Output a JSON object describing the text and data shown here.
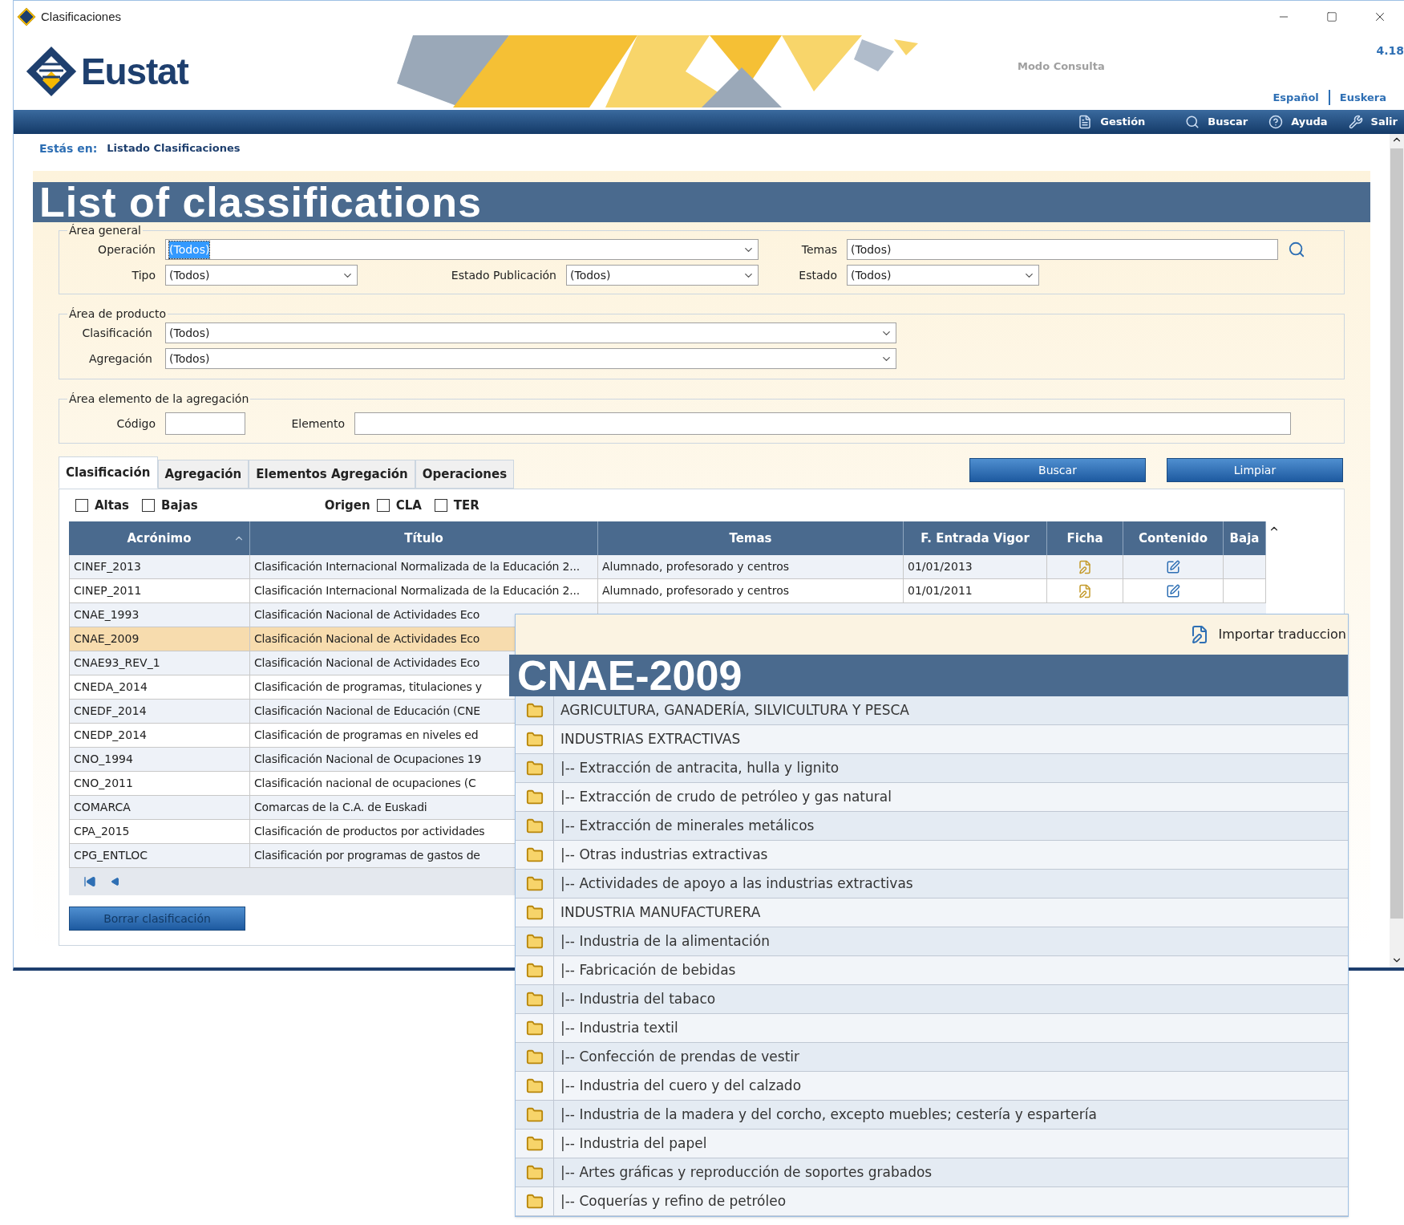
{
  "window": {
    "title": "Clasificaciones"
  },
  "header": {
    "logo_text": "Eustat",
    "mode": "Modo Consulta",
    "version": "4.18",
    "languages": [
      "Español",
      "Euskera"
    ]
  },
  "nav": [
    "Gestión",
    "Buscar",
    "Ayuda",
    "Salir"
  ],
  "breadcrumb": {
    "label": "Estás en:",
    "value": "Listado Clasificaciones"
  },
  "heading": "List of classifications",
  "area_general": {
    "legend": "Área general",
    "operacion": {
      "label": "Operación",
      "value": "(Todos)"
    },
    "temas": {
      "label": "Temas",
      "value": "(Todos)"
    },
    "tipo": {
      "label": "Tipo",
      "value": "(Todos)"
    },
    "estado_publicacion": {
      "label": "Estado Publicación",
      "value": "(Todos)"
    },
    "estado": {
      "label": "Estado",
      "value": "(Todos)"
    }
  },
  "area_producto": {
    "legend": "Área de producto",
    "clasificacion": {
      "label": "Clasificación",
      "value": "(Todos)"
    },
    "agregacion": {
      "label": "Agregación",
      "value": "(Todos)"
    }
  },
  "area_elemento": {
    "legend": "Área elemento de la agregación",
    "codigo": {
      "label": "Código"
    },
    "elemento": {
      "label": "Elemento"
    }
  },
  "tabs": [
    {
      "label": "Clasificación",
      "selected": true
    },
    {
      "label": "Agregación",
      "selected": false
    },
    {
      "label": "Elementos Agregación",
      "selected": false
    },
    {
      "label": "Operaciones",
      "selected": false
    }
  ],
  "buttons": [
    "Buscar",
    "Limpiar"
  ],
  "filters": {
    "altas": {
      "label": "Altas",
      "checked": false
    },
    "bajas": {
      "label": "Bajas",
      "checked": false
    },
    "origen": "Origen",
    "cla": {
      "label": "CLA",
      "checked": false
    },
    "ter": {
      "label": "TER",
      "checked": false
    }
  },
  "table": {
    "columns": [
      "Acrónimo",
      "Título",
      "Temas",
      "F. Entrada Vigor",
      "Ficha",
      "Contenido",
      "Baja"
    ],
    "rows": [
      {
        "acronimo": "CINEF_2013",
        "titulo": "Clasificación Internacional Normalizada de la Educación 2...",
        "temas": "Alumnado, profesorado y centros",
        "fecha": "01/01/2013",
        "selected": false
      },
      {
        "acronimo": "CINEP_2011",
        "titulo": "Clasificación Internacional Normalizada de la Educación 2...",
        "temas": "Alumnado, profesorado y centros",
        "fecha": "01/01/2011",
        "selected": false
      },
      {
        "acronimo": "CNAE_1993",
        "titulo": "Clasificación Nacional de Actividades Eco",
        "selected": false
      },
      {
        "acronimo": "CNAE_2009",
        "titulo": "Clasificación Nacional de Actividades Eco",
        "selected": true
      },
      {
        "acronimo": "CNAE93_REV_1",
        "titulo": "Clasificación Nacional de Actividades Eco",
        "selected": false
      },
      {
        "acronimo": "CNEDA_2014",
        "titulo": "Clasificación de programas, titulaciones y",
        "selected": false
      },
      {
        "acronimo": "CNEDF_2014",
        "titulo": "Clasificación Nacional de Educación (CNE",
        "selected": false
      },
      {
        "acronimo": "CNEDP_2014",
        "titulo": "Clasificación de programas en niveles ed",
        "selected": false
      },
      {
        "acronimo": "CNO_1994",
        "titulo": "Clasificación Nacional de Ocupaciones 19",
        "selected": false
      },
      {
        "acronimo": "CNO_2011",
        "titulo": "Clasificación nacional de ocupaciones (C",
        "selected": false
      },
      {
        "acronimo": "COMARCA",
        "titulo": "Comarcas de la C.A. de Euskadi",
        "selected": false
      },
      {
        "acronimo": "CPA_2015",
        "titulo": "Clasificación de productos por actividades",
        "selected": false
      },
      {
        "acronimo": "CPG_ENTLOC",
        "titulo": "Clasificación por programas de gastos de",
        "selected": false
      }
    ]
  },
  "delete_button": "Borrar clasificación",
  "popup": {
    "action": "Importar traduccion",
    "title": "CNAE-2009",
    "items": [
      "AGRICULTURA, GANADERÍA, SILVICULTURA Y PESCA",
      "INDUSTRIAS EXTRACTIVAS",
      "|-- Extracción de antracita, hulla y lignito",
      "|-- Extracción de crudo de petróleo y gas natural",
      "|-- Extracción de minerales metálicos",
      "|-- Otras industrias extractivas",
      "|-- Actividades de apoyo a las industrias extractivas",
      "INDUSTRIA MANUFACTURERA",
      "|-- Industria de la alimentación",
      "|-- Fabricación de bebidas",
      "|-- Industria del tabaco",
      "|-- Industria textil",
      "|-- Confección de prendas de vestir",
      "|-- Industria del cuero y del calzado",
      "|-- Industria de la madera y del corcho, excepto muebles; cestería y espartería",
      "|-- Industria del papel",
      "|-- Artes gráficas y reproducción de soportes grabados",
      "|-- Coquerías y refino de petróleo"
    ]
  }
}
